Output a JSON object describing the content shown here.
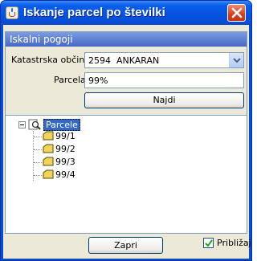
{
  "window": {
    "title": "Iskanje parcel po številki",
    "title_icon": "java-cup-icon",
    "close_icon": "close-icon"
  },
  "search_panel": {
    "header": "Iskalni pogoji",
    "cadastral_label": "Katastrska občina",
    "cadastral_value": "2594  ANKARAN",
    "parcel_label": "Parcela",
    "parcel_value": "99%",
    "search_button": "Najdi"
  },
  "tree": {
    "root_label": "Parcele",
    "root_icon": "search-folder-icon",
    "items": [
      {
        "label": "99/1",
        "icon": "parcel-icon"
      },
      {
        "label": "99/2",
        "icon": "parcel-icon"
      },
      {
        "label": "99/3",
        "icon": "parcel-icon"
      },
      {
        "label": "99/4",
        "icon": "parcel-icon"
      }
    ]
  },
  "footer": {
    "close_button": "Zapri",
    "zoom_checkbox_label": "Približaj",
    "zoom_checked": true
  },
  "colors": {
    "titlebar": "#0653e0",
    "panel_header": "#4469c6",
    "selection": "#316ac5",
    "close_button": "#d4401e",
    "client_bg": "#ece9d8"
  }
}
